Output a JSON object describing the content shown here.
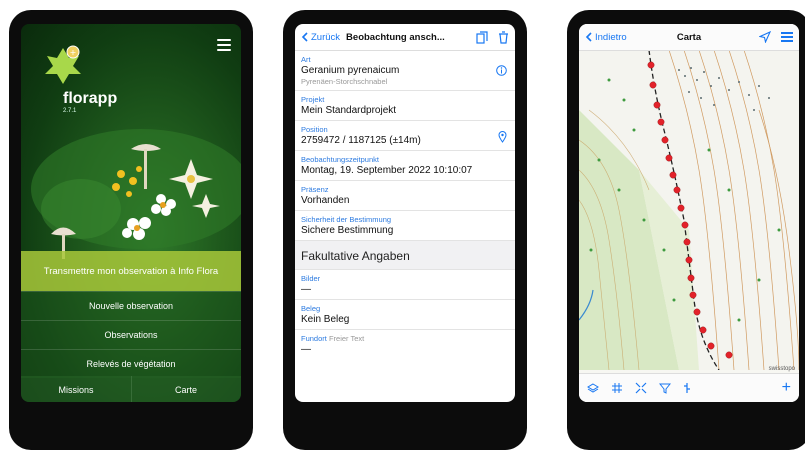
{
  "phone1": {
    "app_name": "florapp",
    "version": "2.7.1",
    "primary_button": "Transmettre mon observation à Info Flora",
    "buttons": [
      "Nouvelle observation",
      "Observations",
      "Relevés de végétation"
    ],
    "bottom_left": "Missions",
    "bottom_right": "Carte"
  },
  "phone2": {
    "back_label": "Zurück",
    "title": "Beobachtung ansch...",
    "fields": [
      {
        "label": "Art",
        "value": "Geranium pyrenaicum",
        "sub": "Pyrenäen-Storchschnabel"
      },
      {
        "label": "Projekt",
        "value": "Mein Standardprojekt"
      },
      {
        "label": "Position",
        "value": "2759472 / 1187125 (±14m)"
      },
      {
        "label": "Beobachtungszeitpunkt",
        "value": "Montag, 19. September 2022 10:10:07"
      },
      {
        "label": "Präsenz",
        "value": "Vorhanden"
      },
      {
        "label": "Sicherheit der Bestimmung",
        "value": "Sichere Bestimmung"
      }
    ],
    "section_title": "Fakultative Angaben",
    "optional_fields": [
      {
        "label": "Bilder",
        "value": "—"
      },
      {
        "label": "Beleg",
        "value": "Kein Beleg"
      },
      {
        "label": "Fundort",
        "hint": "Freier Text",
        "value": "—"
      }
    ]
  },
  "phone3": {
    "back_label": "Indietro",
    "title": "Carta",
    "attribution": "swisstopo"
  },
  "colors": {
    "accent": "#1877f2",
    "label_blue": "#2d7be0",
    "green_button": "#a8c83a",
    "map_red": "#e3222a"
  }
}
